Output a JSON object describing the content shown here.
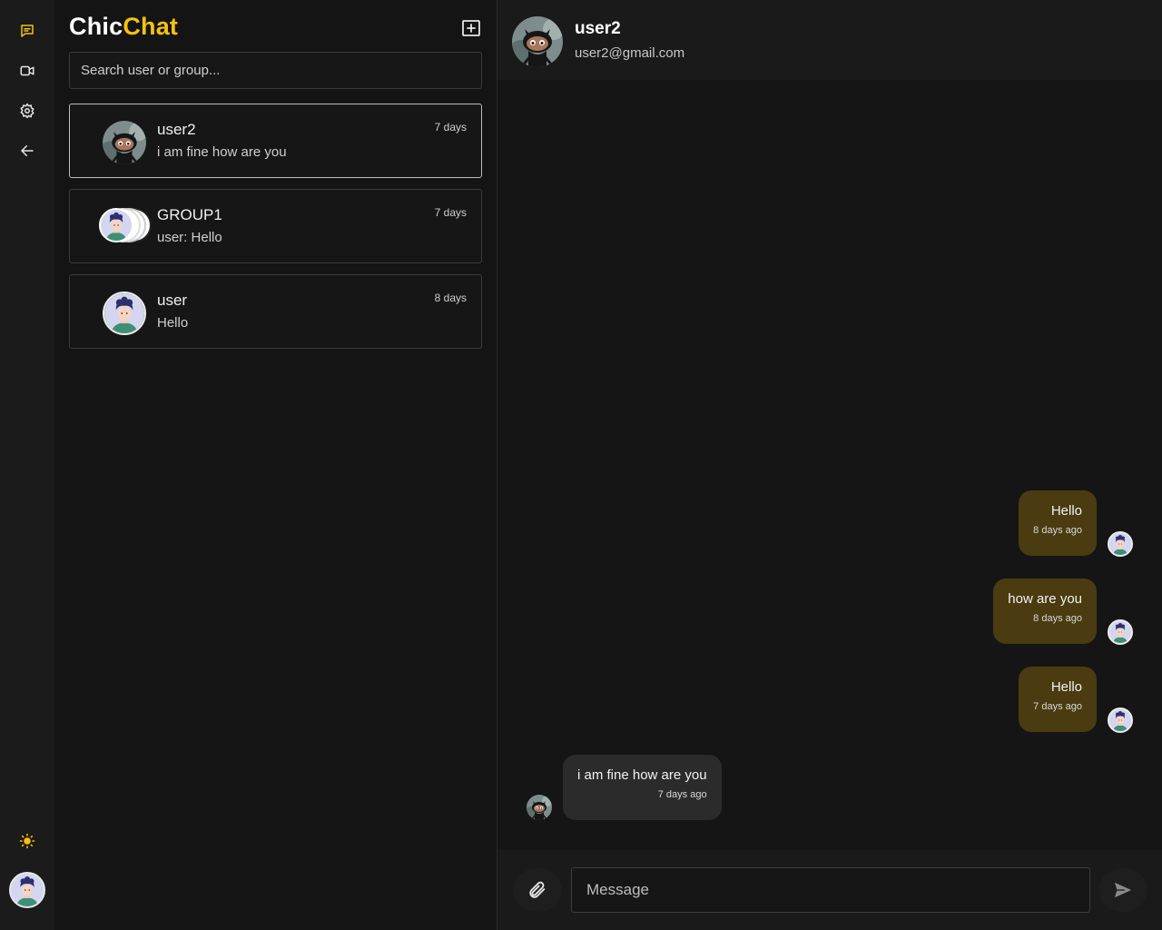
{
  "brand": {
    "part1": "Chic",
    "part2": "Chat"
  },
  "colors": {
    "accent": "#f5c211",
    "outgoing_bubble": "#4a3b10",
    "incoming_bubble": "#2b2b2b",
    "background": "#141414"
  },
  "rail": {
    "items": [
      {
        "icon": "chat-icon",
        "active": true
      },
      {
        "icon": "video-camera-icon",
        "active": false
      },
      {
        "icon": "gear-icon",
        "active": false
      },
      {
        "icon": "arrow-left-icon",
        "active": false
      }
    ],
    "theme_toggle_icon": "sun-icon",
    "profile_avatar_icon": "user-avatar"
  },
  "sidebar": {
    "new_chat_icon": "add-square-icon",
    "search": {
      "placeholder": "Search user or group...",
      "value": ""
    },
    "conversations": [
      {
        "name": "user2",
        "preview": "i am fine how are you",
        "time": "7 days",
        "avatar": "octocat-avatar",
        "active": true
      },
      {
        "name": "GROUP1",
        "preview": "user: Hello",
        "time": "7 days",
        "avatar": "group-avatar-stack",
        "active": false
      },
      {
        "name": "user",
        "preview": "Hello",
        "time": "8 days",
        "avatar": "user-avatar",
        "active": false
      }
    ]
  },
  "chat": {
    "header": {
      "name": "user2",
      "email": "user2@gmail.com"
    },
    "messages": [
      {
        "direction": "out",
        "text": "Hello",
        "time": "8 days ago"
      },
      {
        "direction": "out",
        "text": "how are you",
        "time": "8 days ago"
      },
      {
        "direction": "out",
        "text": "Hello",
        "time": "7 days ago"
      },
      {
        "direction": "in",
        "text": "i am fine how are you",
        "time": "7 days ago"
      }
    ],
    "composer": {
      "placeholder": "Message",
      "value": "",
      "attach_icon": "paperclip-icon",
      "send_icon": "send-icon"
    }
  }
}
